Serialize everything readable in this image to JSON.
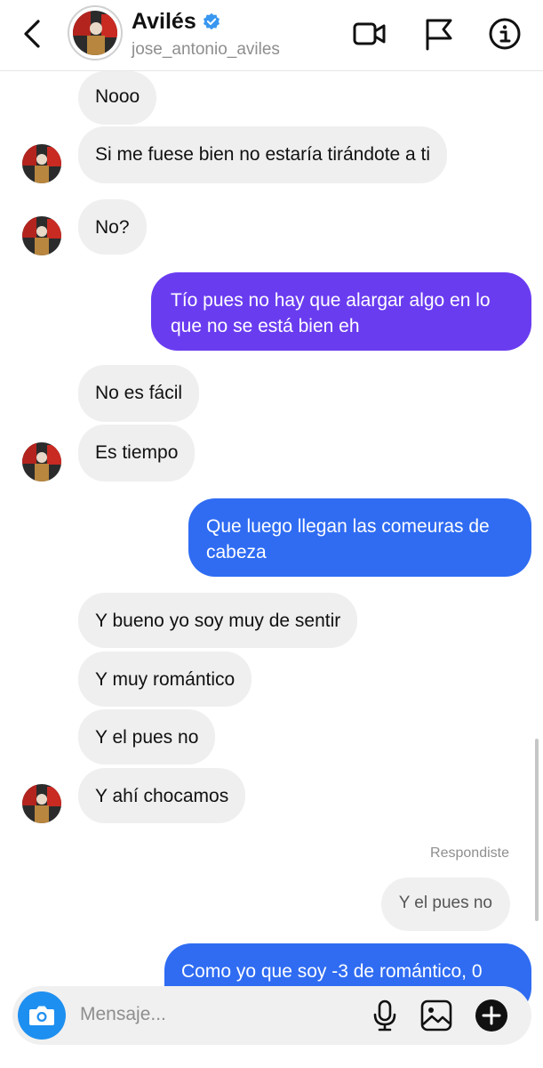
{
  "header": {
    "title": "Avilés",
    "username": "jose_antonio_aviles"
  },
  "messages": {
    "m1": "Nooo",
    "m2": "Si me fuese bien no estaría tirándote a ti",
    "m3": "No?",
    "m4": "Tío pues no hay que alargar algo en lo que no se está bien eh",
    "m5": "No es fácil",
    "m6": "Es tiempo",
    "m7": "Que luego llegan las comeuras de cabeza",
    "m8": "Y bueno yo soy muy de sentir",
    "m9": "Y muy romántico",
    "m10": "Y el pues no",
    "m11": "Y ahí chocamos",
    "reply_label": "Respondiste",
    "reply_quote": "Y el pues no",
    "m12": "Como yo que soy -3 de romántico, 0"
  },
  "composer": {
    "placeholder": "Mensaje..."
  },
  "colors": {
    "outgoing_purple": "#6a3cf0",
    "outgoing_blue": "#2f6cf2",
    "verified_blue": "#3897f0",
    "camera_blue": "#1d8ff0"
  },
  "icons": [
    "back-chevron-icon",
    "verified-badge-icon",
    "video-call-icon",
    "flag-icon",
    "info-icon",
    "camera-icon",
    "microphone-icon",
    "image-icon",
    "plus-icon"
  ]
}
